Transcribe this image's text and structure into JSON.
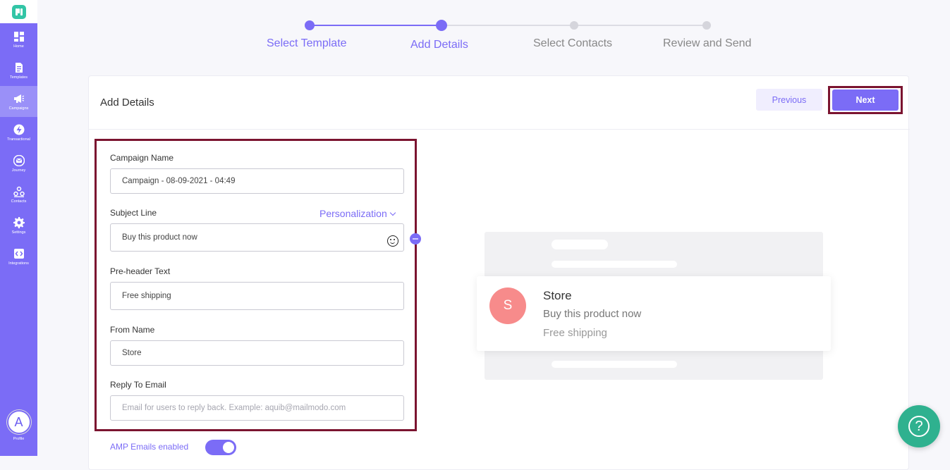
{
  "sidebar": {
    "items": [
      {
        "label": "Home",
        "icon": "home-grid-icon"
      },
      {
        "label": "Templates",
        "icon": "templates-doc-icon"
      },
      {
        "label": "Campaigns",
        "icon": "megaphone-icon",
        "active": true
      },
      {
        "label": "Transactional",
        "icon": "lightning-icon"
      },
      {
        "label": "Journey",
        "icon": "journey-mail-icon"
      },
      {
        "label": "Contacts",
        "icon": "contacts-group-icon"
      },
      {
        "label": "Settings",
        "icon": "gear-icon"
      },
      {
        "label": "Integrations",
        "icon": "code-brackets-icon"
      }
    ],
    "profile": {
      "initial": "A",
      "label": "Profile"
    }
  },
  "stepper": {
    "steps": [
      {
        "label": "Select Template",
        "state": "done"
      },
      {
        "label": "Add Details",
        "state": "active"
      },
      {
        "label": "Select Contacts",
        "state": "pending"
      },
      {
        "label": "Review and Send",
        "state": "pending"
      }
    ]
  },
  "card": {
    "title": "Add Details",
    "previous_label": "Previous",
    "next_label": "Next"
  },
  "form": {
    "campaign_name": {
      "label": "Campaign Name",
      "value": "Campaign - 08-09-2021 - 04:49"
    },
    "subject_line": {
      "label": "Subject Line",
      "value": "Buy this product now",
      "personalization_label": "Personalization"
    },
    "preheader": {
      "label": "Pre-header Text",
      "value": "Free shipping"
    },
    "from_name": {
      "label": "From Name",
      "value": "Store"
    },
    "reply_to": {
      "label": "Reply To Email",
      "value": "",
      "placeholder": "Email for users to reply back. Example: aquib@mailmodo.com"
    },
    "amp_label": "AMP Emails enabled",
    "amp_enabled": true
  },
  "preview": {
    "avatar_initial": "S",
    "name": "Store",
    "subject": "Buy this product now",
    "preheader": "Free shipping"
  },
  "help": {
    "glyph": "?"
  },
  "colors": {
    "accent": "#7b6cf6",
    "highlight_border": "#7b1430",
    "help": "#2fb18f",
    "preview_avatar": "#f78b8b"
  }
}
